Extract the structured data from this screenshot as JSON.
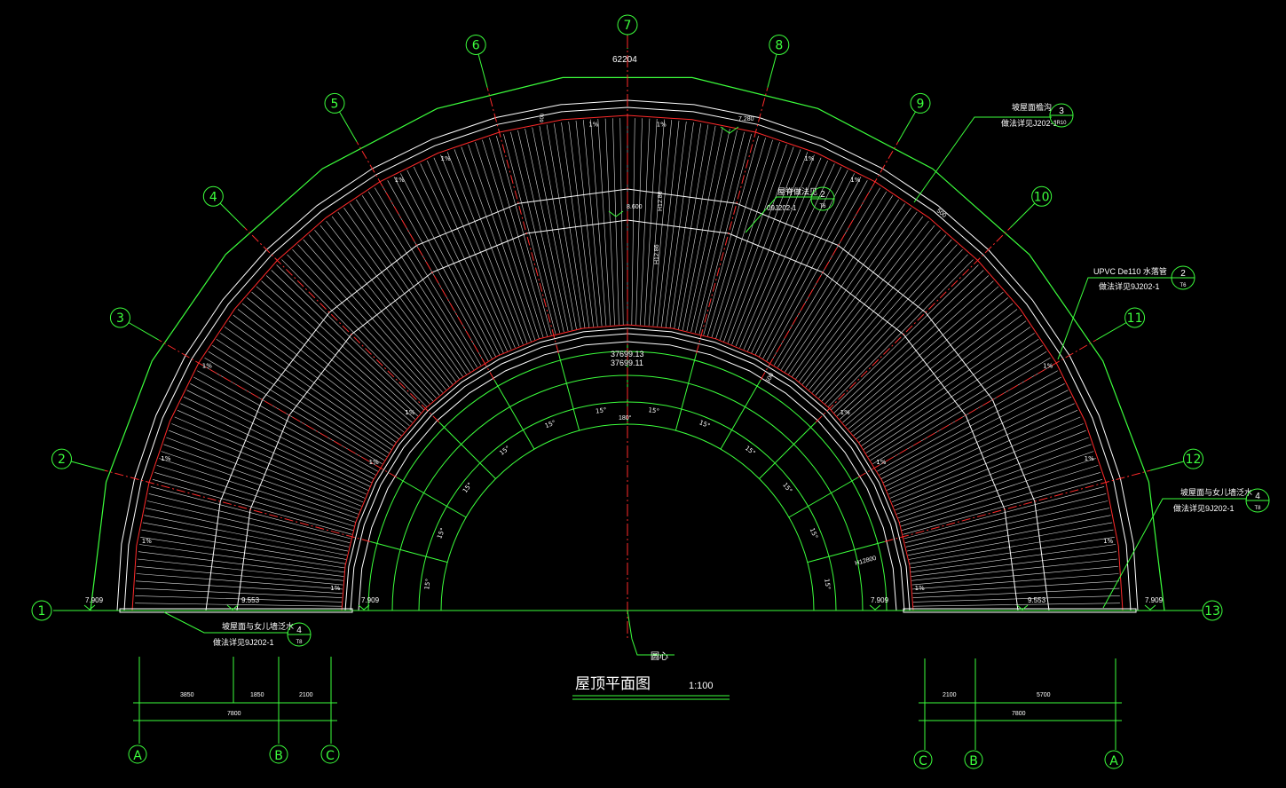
{
  "drawing": {
    "title": "屋顶平面图",
    "scale": "1:100",
    "center_label": "圆心"
  },
  "axes": {
    "radial": [
      "1",
      "2",
      "3",
      "4",
      "5",
      "6",
      "7",
      "8",
      "9",
      "10",
      "11",
      "12",
      "13"
    ],
    "left_grid": [
      "A",
      "B",
      "C"
    ],
    "right_grid": [
      "C",
      "B",
      "A"
    ]
  },
  "dimensions": {
    "top_length": "62204",
    "inner_arc_1": "37699.13",
    "inner_arc_2": "37699.11",
    "left_bottom_row1": [
      "3850",
      "1850",
      "2100"
    ],
    "left_bottom_total": "7800",
    "right_bottom_row1": [
      "2100",
      "5700"
    ],
    "right_bottom_total": "7800",
    "base_left_outer": "7.909",
    "base_left_mid": "9.553",
    "base_left_inner": "7.909",
    "base_right_inner": "7.909",
    "base_right_mid": "9.553",
    "base_right_outer": "7.909",
    "top_marker_right": "7.280",
    "ridge_elev": "8.600",
    "h1": "H12.86",
    "h2": "H12.86",
    "dim_500_a": "500",
    "dim_500_b": "500",
    "h_right": "H12800",
    "center_angle": "180°",
    "sector_angle": "15°",
    "slope": "1%",
    "dim_600": "600"
  },
  "notes": {
    "gutter_title": "坡屋面檐沟",
    "gutter_ref": "做法详见J202-1",
    "gutter_bubble_num": "3",
    "gutter_bubble_sheet": "R10",
    "ridge_title": "屋脊做法见",
    "ridge_ref": "09J202-1",
    "ridge_bubble_num": "2",
    "ridge_bubble_sheet": "T6",
    "pipe_title": "UPVC  De110  水落管",
    "pipe_ref": "做法详见9J202-1",
    "pipe_bubble_num": "2",
    "pipe_bubble_sheet": "T6",
    "parapet_right_title": "坡屋面与女儿墙泛水",
    "parapet_right_ref": "做法详见9J202-1",
    "parapet_right_num": "4",
    "parapet_right_sheet": "T8",
    "parapet_left_title": "坡屋面与女儿墙泛水",
    "parapet_left_ref": "做法详见9J202-1",
    "parapet_left_num": "4",
    "parapet_left_sheet": "T8"
  },
  "colors": {
    "green": "#3cff3c",
    "white": "#ffffff",
    "red": "#ff2a2a",
    "background": "#000000"
  }
}
